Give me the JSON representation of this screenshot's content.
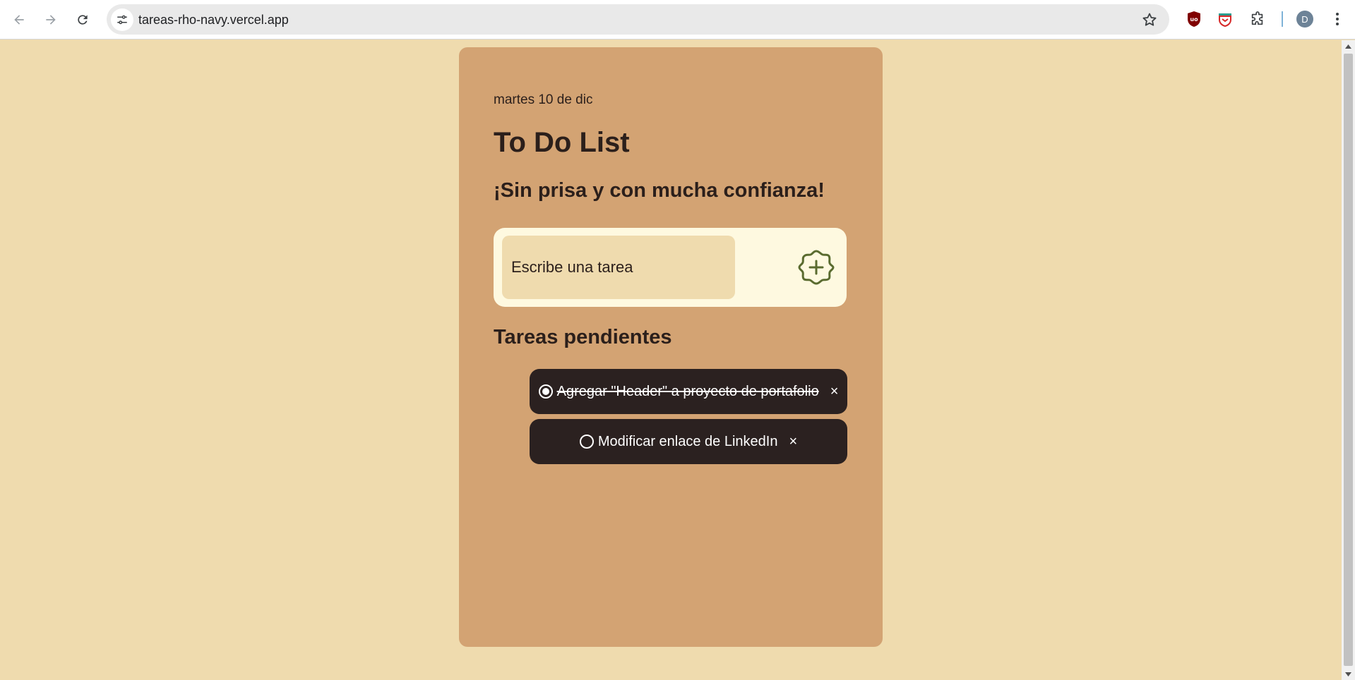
{
  "browser": {
    "url": "tareas-rho-navy.vercel.app",
    "profile_initial": "D"
  },
  "page": {
    "date": "martes 10 de dic",
    "title": "To Do List",
    "subtitle": "¡Sin prisa y con mucha confianza!",
    "input_placeholder": "Escribe una tarea",
    "section_title": "Tareas pendientes",
    "tasks": [
      {
        "text": "Agregar \"Header\" a proyecto de portafolio",
        "completed": true,
        "delete_label": "×"
      },
      {
        "text": "Modificar enlace de LinkedIn",
        "completed": false,
        "delete_label": "×"
      }
    ]
  },
  "colors": {
    "page_bg": "#efdbae",
    "card_bg": "#d3a373",
    "form_bg": "#fef9e0",
    "task_bg": "#2b2120",
    "text_dark": "#2b1f1b",
    "accent_green": "#5a6b2f"
  }
}
